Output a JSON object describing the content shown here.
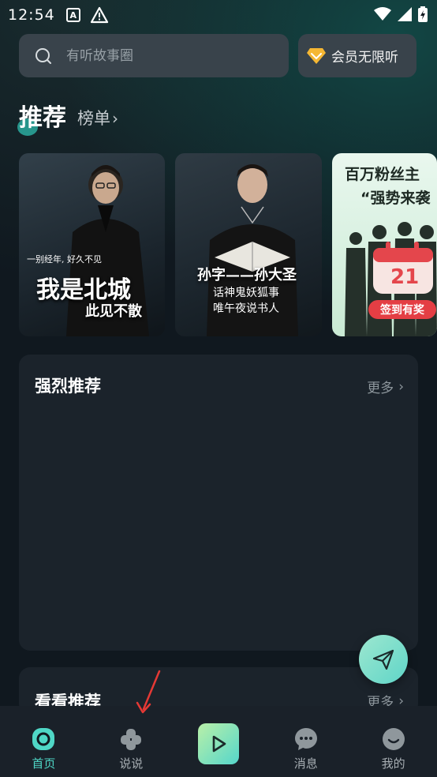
{
  "status_bar": {
    "time": "12:54",
    "a_badge": "A"
  },
  "search": {
    "placeholder": "有听故事圈"
  },
  "vip": {
    "label": "会员无限听"
  },
  "tabs": {
    "active": "推荐",
    "inactive": "榜单"
  },
  "banners": [
    {
      "line1": "一别经年, 好久不见",
      "title": "我是北城",
      "subtitle": "此见不散"
    },
    {
      "title": "孙字——孙大圣",
      "line1": "话神鬼妖狐事",
      "line2": "唯午夜说书人"
    },
    {
      "line1": "百万粉丝主",
      "line2": "“强势来袭",
      "calendar_day": "21",
      "badge": "签到有奖"
    }
  ],
  "sections": [
    {
      "title": "强烈推荐",
      "more": "更多"
    },
    {
      "title": "看看推荐",
      "more": "更多"
    }
  ],
  "nav": {
    "home": "首页",
    "shuoshuo": "说说",
    "messages": "消息",
    "mine": "我的"
  },
  "colors": {
    "accent": "#4fd7c6",
    "annotation": "#e53935",
    "background": "#10181f"
  }
}
